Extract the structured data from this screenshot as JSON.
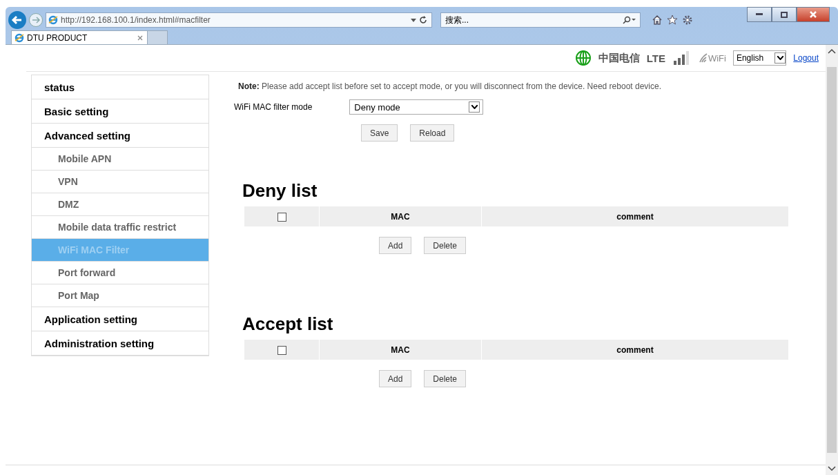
{
  "browser": {
    "url": "http://192.168.100.1/index.html#macfilter",
    "search_placeholder": "搜索...",
    "tab_title": "DTU PRODUCT"
  },
  "header": {
    "carrier": "中国电信",
    "network": "LTE",
    "wifi_label": "WiFi",
    "language": "English",
    "logout": "Logout"
  },
  "sidebar": {
    "items": [
      {
        "label": "status",
        "selected": false
      },
      {
        "label": "Basic setting",
        "selected": false
      },
      {
        "label": "Advanced setting",
        "selected": false,
        "children": [
          {
            "label": "Mobile APN",
            "selected": false
          },
          {
            "label": "VPN",
            "selected": false
          },
          {
            "label": "DMZ",
            "selected": false
          },
          {
            "label": "Mobile data traffic restrict",
            "selected": false
          },
          {
            "label": "WiFi MAC Filter",
            "selected": true
          },
          {
            "label": "Port forward",
            "selected": false
          },
          {
            "label": "Port Map",
            "selected": false
          }
        ]
      },
      {
        "label": "Application setting",
        "selected": false
      },
      {
        "label": "Administration setting",
        "selected": false
      }
    ]
  },
  "note": "**Note:** Please add accept list before set to accept mode, or you will disconnect from the device. Need reboot device.",
  "filter": {
    "label": "WiFi MAC filter mode",
    "value": "Deny mode",
    "buttons": [
      "Save",
      "Reload"
    ]
  },
  "lists": [
    {
      "title": "Deny list",
      "checked": false,
      "columns": [
        "MAC",
        "comment"
      ],
      "buttons": [
        "Add",
        "Delete"
      ]
    },
    {
      "title": "Accept list",
      "checked": false,
      "columns": [
        "MAC",
        "comment"
      ],
      "buttons": [
        "Add",
        "Delete"
      ]
    }
  ]
}
